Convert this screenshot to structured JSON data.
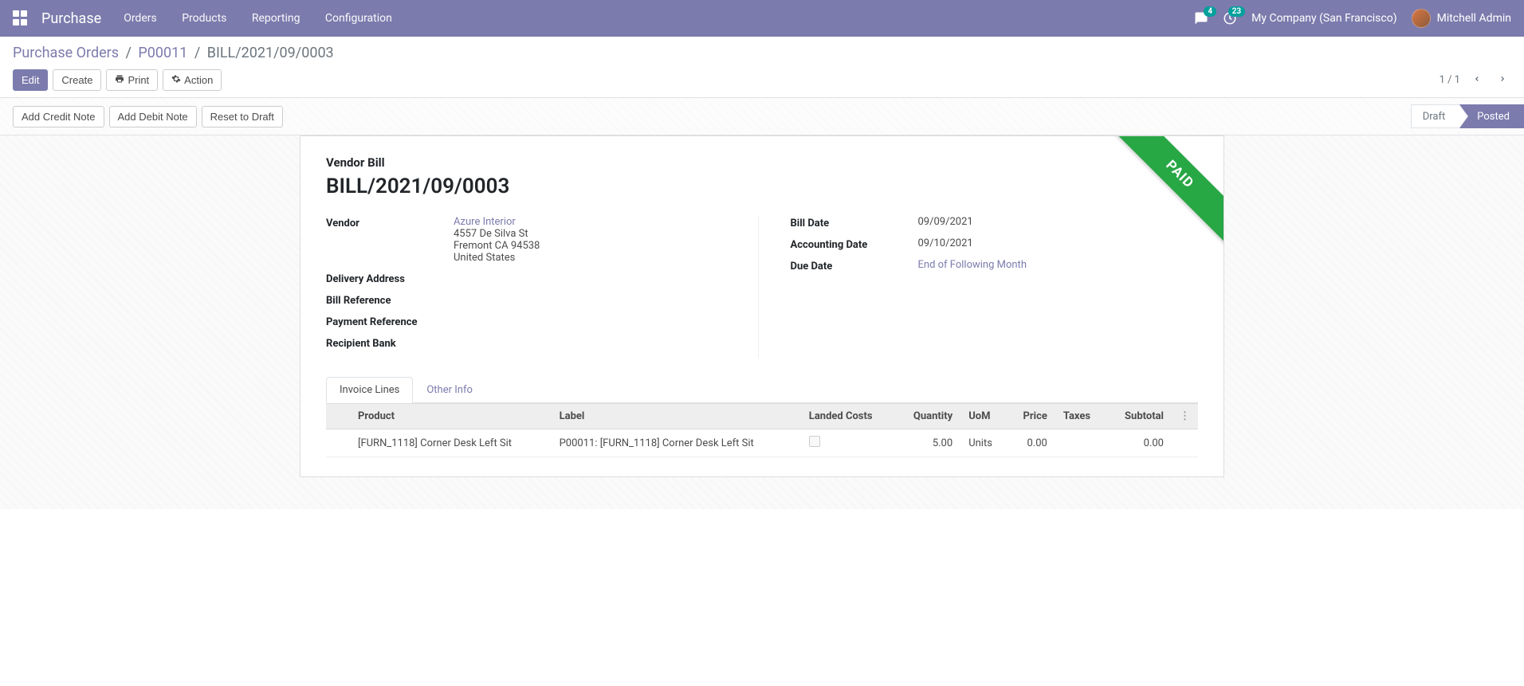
{
  "nav": {
    "brand": "Purchase",
    "menu": [
      "Orders",
      "Products",
      "Reporting",
      "Configuration"
    ],
    "msg_count": "4",
    "activity_count": "23",
    "company": "My Company (San Francisco)",
    "user": "Mitchell Admin"
  },
  "breadcrumb": {
    "root": "Purchase Orders",
    "parent": "P00011",
    "current": "BILL/2021/09/0003"
  },
  "buttons": {
    "edit": "Edit",
    "create": "Create",
    "print": "Print",
    "action": "Action",
    "add_credit": "Add Credit Note",
    "add_debit": "Add Debit Note",
    "reset_draft": "Reset to Draft"
  },
  "pager": {
    "text": "1 / 1"
  },
  "status": {
    "draft": "Draft",
    "posted": "Posted",
    "ribbon": "PAID"
  },
  "form": {
    "title_label": "Vendor Bill",
    "title": "BILL/2021/09/0003",
    "labels": {
      "vendor": "Vendor",
      "delivery": "Delivery Address",
      "billref": "Bill Reference",
      "payref": "Payment Reference",
      "bank": "Recipient Bank",
      "billdate": "Bill Date",
      "acctdate": "Accounting Date",
      "duedate": "Due Date"
    },
    "vendor": {
      "name": "Azure Interior",
      "street": "4557 De Silva St",
      "city": "Fremont CA 94538",
      "country": "United States"
    },
    "bill_date": "09/09/2021",
    "accounting_date": "09/10/2021",
    "due_date": "End of Following Month"
  },
  "tabs": {
    "invoice_lines": "Invoice Lines",
    "other_info": "Other Info"
  },
  "table": {
    "headers": {
      "product": "Product",
      "label": "Label",
      "landed": "Landed Costs",
      "qty": "Quantity",
      "uom": "UoM",
      "price": "Price",
      "taxes": "Taxes",
      "subtotal": "Subtotal"
    },
    "rows": [
      {
        "product": "[FURN_1118] Corner Desk Left Sit",
        "label": "P00011: [FURN_1118] Corner Desk Left Sit",
        "qty": "5.00",
        "uom": "Units",
        "price": "0.00",
        "taxes": "",
        "subtotal": "0.00"
      }
    ]
  }
}
